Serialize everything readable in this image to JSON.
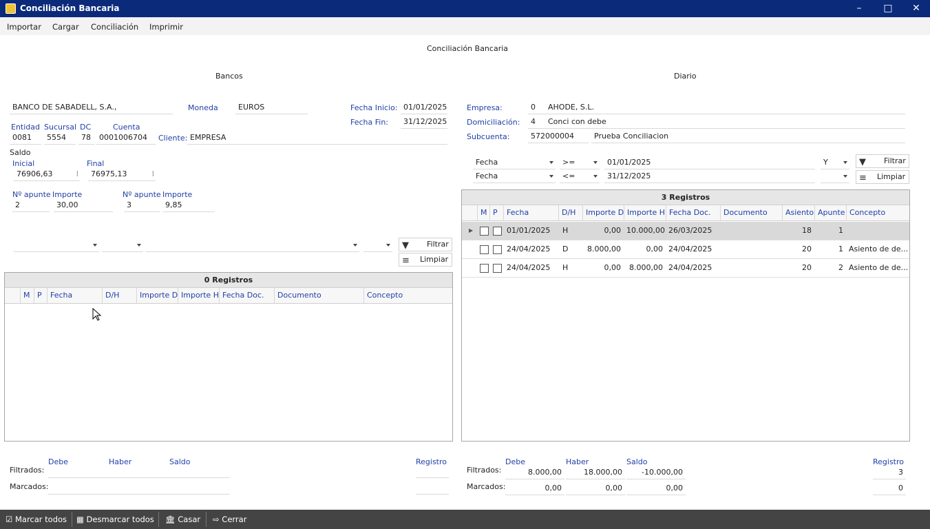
{
  "window": {
    "title": "Conciliación Bancaria"
  },
  "menu": [
    "Importar",
    "Cargar",
    "Conciliación",
    "Imprimir"
  ],
  "page_title": "Conciliación Bancaria",
  "bancos": {
    "section_label": "Bancos",
    "bank_name": "BANCO DE SABADELL, S.A.,",
    "moneda_label": "Moneda",
    "moneda_value": "EUROS",
    "fecha_inicio_label": "Fecha Inicio:",
    "fecha_inicio_value": "01/01/2025",
    "fecha_fin_label": "Fecha Fin:",
    "fecha_fin_value": "31/12/2025",
    "entidad_label": "Entidad",
    "entidad_value": "0081",
    "sucursal_label": "Sucursal",
    "sucursal_value": "5554",
    "dc_label": "DC",
    "dc_value": "78",
    "cuenta_label": "Cuenta",
    "cuenta_value": "0001006704",
    "cliente_label": "Cliente:",
    "cliente_value": "EMPRESA",
    "saldo_label": "Saldo",
    "inicial_label": "Inicial",
    "inicial_value": "76906,63",
    "inicial_suffix": "I",
    "final_label": "Final",
    "final_value": "76975,13",
    "final_suffix": "I",
    "apunte1_label": "Nº apunte",
    "apunte1_value": "2",
    "importe1_label": "Importe",
    "importe1_value": "30,00",
    "apunte2_label": "Nº apunte",
    "apunte2_value": "3",
    "importe2_label": "Importe",
    "importe2_value": "9,85",
    "filtrar_label": "Filtrar",
    "limpiar_label": "Limpiar",
    "grid": {
      "title": "0 Registros",
      "columns": [
        "M",
        "P",
        "Fecha",
        "D/H",
        "Importe D",
        "Importe H",
        "Fecha Doc.",
        "Documento",
        "Concepto"
      ]
    },
    "totals": {
      "debe_label": "Debe",
      "haber_label": "Haber",
      "saldo_label": "Saldo",
      "registro_label": "Registro",
      "filtrados_label": "Filtrados:",
      "marcados_label": "Marcados:"
    }
  },
  "diario": {
    "section_label": "Diario",
    "empresa_label": "Empresa:",
    "empresa_code": "0",
    "empresa_name": "AHODE, S.L.",
    "domiciliacion_label": "Domiciliación:",
    "domiciliacion_code": "4",
    "domiciliacion_name": "Conci con debe",
    "subcuenta_label": "Subcuenta:",
    "subcuenta_code": "572000004",
    "subcuenta_name": "Prueba Conciliacion",
    "filter1": {
      "field": "Fecha",
      "op": ">=",
      "value": "01/01/2025",
      "join": "Y"
    },
    "filter2": {
      "field": "Fecha",
      "op": "<=",
      "value": "31/12/2025",
      "join": ""
    },
    "filtrar_label": "Filtrar",
    "limpiar_label": "Limpiar",
    "grid": {
      "title": "3 Registros",
      "columns": [
        "M",
        "P",
        "Fecha",
        "D/H",
        "Importe D",
        "Importe H",
        "Fecha Doc.",
        "Documento",
        "Asiento",
        "Apunte",
        "Concepto"
      ],
      "rows": [
        {
          "fecha": "01/01/2025",
          "dh": "H",
          "importe_d": "0,00",
          "importe_h": "10.000,00",
          "fecha_doc": "26/03/2025",
          "documento": "",
          "asiento": "18",
          "apunte": "1",
          "concepto": ""
        },
        {
          "fecha": "24/04/2025",
          "dh": "D",
          "importe_d": "8.000,00",
          "importe_h": "0,00",
          "fecha_doc": "24/04/2025",
          "documento": "",
          "asiento": "20",
          "apunte": "1",
          "concepto": "Asiento de de..."
        },
        {
          "fecha": "24/04/2025",
          "dh": "H",
          "importe_d": "0,00",
          "importe_h": "8.000,00",
          "fecha_doc": "24/04/2025",
          "documento": "",
          "asiento": "20",
          "apunte": "2",
          "concepto": "Asiento de de..."
        }
      ]
    },
    "totals": {
      "debe_label": "Debe",
      "haber_label": "Haber",
      "saldo_label": "Saldo",
      "registro_label": "Registro",
      "filtrados_label": "Filtrados:",
      "marcados_label": "Marcados:",
      "filtrados_debe": "8.000,00",
      "filtrados_haber": "18.000,00",
      "filtrados_saldo": "-10.000,00",
      "filtrados_registro": "3",
      "marcados_debe": "0,00",
      "marcados_haber": "0,00",
      "marcados_saldo": "0,00",
      "marcados_registro": "0"
    }
  },
  "statusbar": {
    "marcar_todos": "Marcar todos",
    "desmarcar_todos": "Desmarcar todos",
    "casar": "Casar",
    "cerrar": "Cerrar"
  }
}
